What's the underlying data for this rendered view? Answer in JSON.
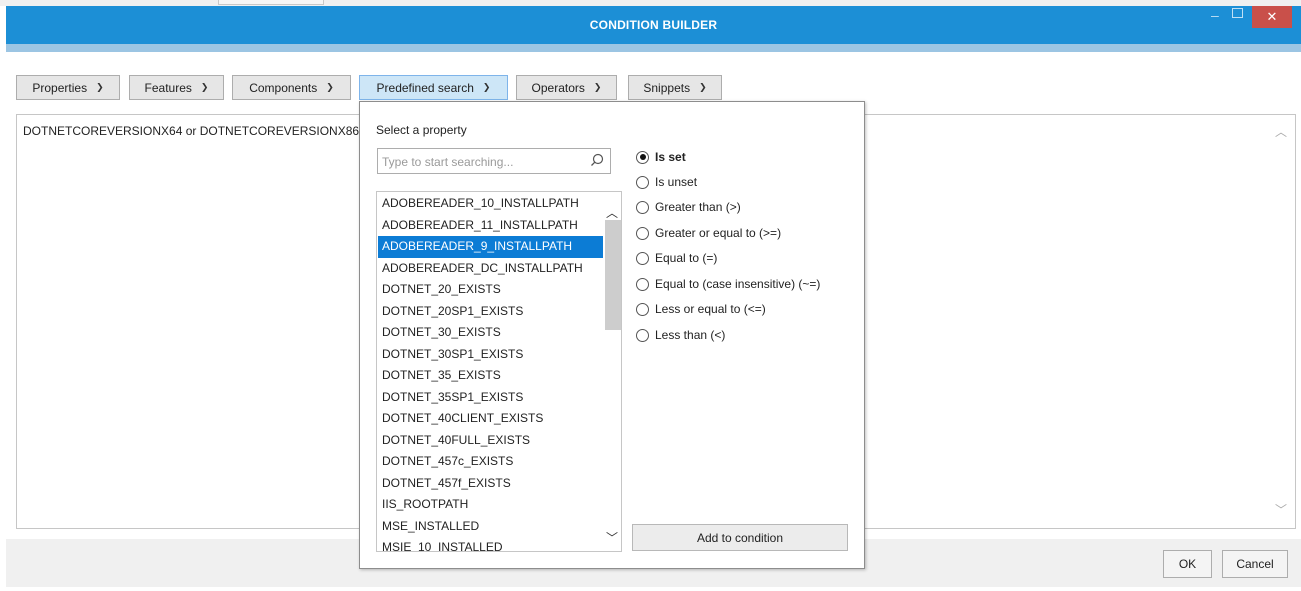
{
  "window": {
    "title": "CONDITION BUILDER",
    "minimize": "–",
    "close": "✕"
  },
  "menus": [
    {
      "label": "Properties"
    },
    {
      "label": "Features"
    },
    {
      "label": "Components"
    },
    {
      "label": "Predefined search"
    },
    {
      "label": "Operators"
    },
    {
      "label": "Snippets"
    }
  ],
  "editor": {
    "expression": "DOTNETCOREVERSIONX64 or DOTNETCOREVERSIONX86"
  },
  "popup": {
    "label": "Select a property",
    "search_placeholder": "Type to start searching...",
    "properties": [
      "ADOBEREADER_10_INSTALLPATH",
      "ADOBEREADER_11_INSTALLPATH",
      "ADOBEREADER_9_INSTALLPATH",
      "ADOBEREADER_DC_INSTALLPATH",
      "DOTNET_20_EXISTS",
      "DOTNET_20SP1_EXISTS",
      "DOTNET_30_EXISTS",
      "DOTNET_30SP1_EXISTS",
      "DOTNET_35_EXISTS",
      "DOTNET_35SP1_EXISTS",
      "DOTNET_40CLIENT_EXISTS",
      "DOTNET_40FULL_EXISTS",
      "DOTNET_457c_EXISTS",
      "DOTNET_457f_EXISTS",
      "IIS_ROOTPATH",
      "MSE_INSTALLED",
      "MSIE_10_INSTALLED"
    ],
    "selected_property": "ADOBEREADER_9_INSTALLPATH",
    "operators": [
      {
        "label": "Is set",
        "checked": true
      },
      {
        "label": "Is unset",
        "checked": false
      },
      {
        "label": "Greater than (>)",
        "checked": false
      },
      {
        "label": "Greater or equal to (>=)",
        "checked": false
      },
      {
        "label": "Equal to (=)",
        "checked": false
      },
      {
        "label": "Equal to (case insensitive) (~=)",
        "checked": false
      },
      {
        "label": "Less or equal to (<=)",
        "checked": false
      },
      {
        "label": "Less than (<)",
        "checked": false
      }
    ],
    "add_button": "Add to condition"
  },
  "footer": {
    "ok": "OK",
    "cancel": "Cancel"
  },
  "icons": {
    "dropdown": "chevron-down-icon",
    "dropup": "chevron-up-icon",
    "search": "search-icon",
    "close": "close-icon",
    "minimize": "minimize-icon",
    "maximize": "maximize-icon"
  },
  "colors": {
    "titlebar": "#1c8fd6",
    "selection": "#0c7cd5",
    "close": "#c9504a",
    "active_menu": "#cde6f7"
  }
}
